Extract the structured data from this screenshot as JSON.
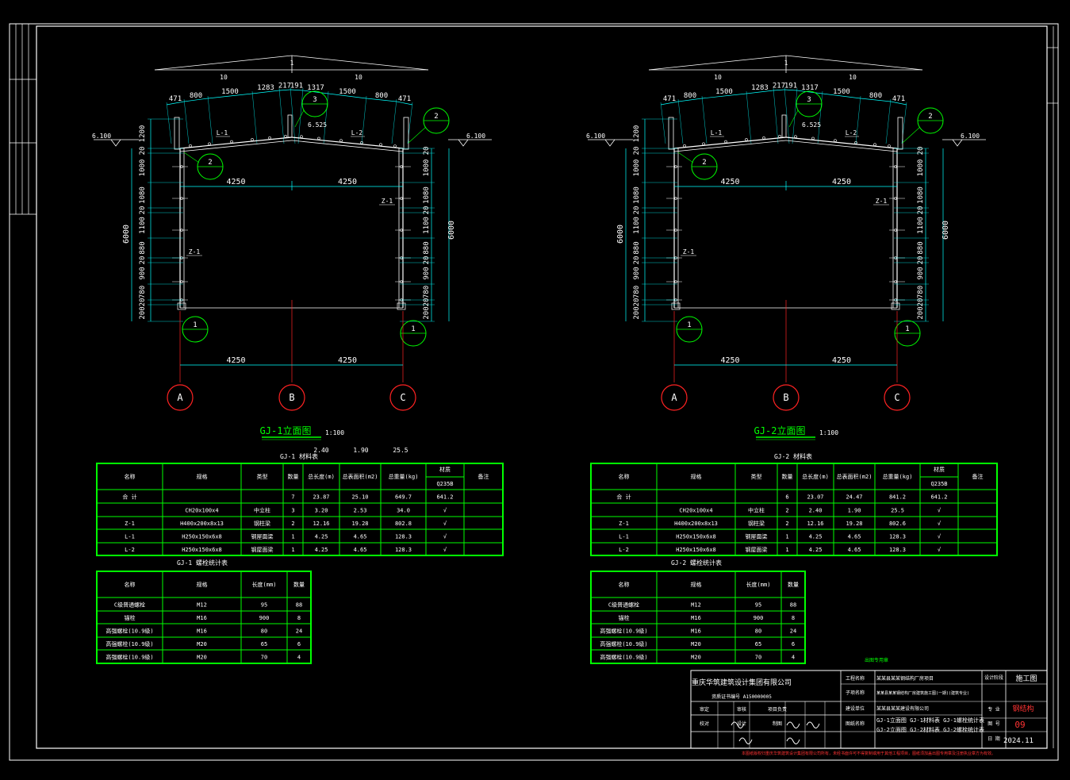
{
  "frames": [
    {
      "id": "gj1",
      "top_dims": [
        "10",
        "10"
      ],
      "top_mark": "1",
      "roof_dims": [
        "471",
        "800",
        "1500",
        "1283",
        "217",
        "191",
        "1317",
        "1500",
        "800",
        "471"
      ],
      "elev_left": "6.100",
      "elev_right": "6.100",
      "elev_mid": "6.525",
      "beam_labels": [
        "L-1",
        "L-2"
      ],
      "col_labels": [
        "Z-1",
        "Z-1"
      ],
      "inner_span": [
        "4250",
        "4250"
      ],
      "bottom_span": [
        "4250",
        "4250"
      ],
      "left_dims": [
        "1200",
        "20",
        "1000",
        "1080",
        "20",
        "1100",
        "880",
        "20",
        "900",
        "780",
        "20",
        "200"
      ],
      "right_dims": [
        "20",
        "1000",
        "1080",
        "20",
        "1100",
        "880",
        "20",
        "900",
        "780",
        "20",
        "200"
      ],
      "height_total": "6000",
      "callouts": [
        "2",
        "3",
        "2",
        "1",
        "1"
      ],
      "axes": [
        "A",
        "B",
        "C"
      ],
      "title": "GJ-1立面图",
      "scale": "1:100",
      "loose_values": [
        "2.40",
        "1.90",
        "25.5"
      ],
      "material_table": {
        "title": "GJ-1 材料表",
        "headers": [
          "名称",
          "规格",
          "类型",
          "数量",
          "总长度(m)",
          "总表面积(m2)",
          "总重量(kg)",
          "材质",
          "备注"
        ],
        "material_sub": "Q235B",
        "rows": [
          [
            "合 计",
            "",
            "",
            "7",
            "23.87",
            "25.10",
            "649.7",
            "641.2",
            ""
          ],
          [
            "",
            "CH20x100x4",
            "中立柱",
            "3",
            "3.20",
            "2.53",
            "34.0",
            "√",
            ""
          ],
          [
            "Z-1",
            "H400x200x8x13",
            "钢柱梁",
            "2",
            "12.16",
            "19.28",
            "802.8",
            "√",
            ""
          ],
          [
            "L-1",
            "H250x150x6x8",
            "钢屋面梁",
            "1",
            "4.25",
            "4.65",
            "128.3",
            "√",
            ""
          ],
          [
            "L-2",
            "H250x150x6x8",
            "钢屋面梁",
            "1",
            "4.25",
            "4.65",
            "128.3",
            "√",
            ""
          ]
        ]
      },
      "bolt_table": {
        "title": "GJ-1 螺栓统计表",
        "headers": [
          "名称",
          "规格",
          "长度(mm)",
          "数量"
        ],
        "rows": [
          [
            "C级普通螺栓",
            "M12",
            "95",
            "88"
          ],
          [
            "锚栓",
            "M16",
            "900",
            "8"
          ],
          [
            "高强螺栓(10.9级)",
            "M16",
            "80",
            "24"
          ],
          [
            "高强螺栓(10.9级)",
            "M20",
            "65",
            "6"
          ],
          [
            "高强螺栓(10.9级)",
            "M20",
            "70",
            "4"
          ]
        ]
      }
    },
    {
      "id": "gj2",
      "top_dims": [
        "10",
        "10"
      ],
      "top_mark": "1",
      "roof_dims": [
        "471",
        "800",
        "1500",
        "1283",
        "217",
        "191",
        "1317",
        "1500",
        "800",
        "471"
      ],
      "elev_left": "6.100",
      "elev_right": "6.100",
      "elev_mid": "6.525",
      "beam_labels": [
        "L-1",
        "L-2"
      ],
      "col_labels": [
        "Z-1",
        "Z-1"
      ],
      "inner_span": [
        "4250",
        "4250"
      ],
      "bottom_span": [
        "4250",
        "4250"
      ],
      "left_dims": [
        "1200",
        "20",
        "1000",
        "1080",
        "20",
        "1100",
        "880",
        "20",
        "900",
        "780",
        "20",
        "200"
      ],
      "right_dims": [
        "20",
        "1000",
        "1080",
        "20",
        "1100",
        "880",
        "20",
        "900",
        "780",
        "20",
        "200"
      ],
      "height_total": "6000",
      "callouts": [
        "2",
        "3",
        "2",
        "1",
        "1"
      ],
      "axes": [
        "A",
        "B",
        "C"
      ],
      "title": "GJ-2立面图",
      "scale": "1:100",
      "loose_values": [],
      "material_table": {
        "title": "GJ-2 材料表",
        "headers": [
          "名称",
          "规格",
          "类型",
          "数量",
          "总长度(m)",
          "总表面积(m2)",
          "总重量(kg)",
          "材质",
          "备注"
        ],
        "material_sub": "Q235B",
        "rows": [
          [
            "合 计",
            "",
            "",
            "6",
            "23.07",
            "24.47",
            "841.2",
            "641.2",
            ""
          ],
          [
            "",
            "CH20x100x4",
            "中立柱",
            "2",
            "2.40",
            "1.90",
            "25.5",
            "√",
            ""
          ],
          [
            "Z-1",
            "H400x200x8x13",
            "钢柱梁",
            "2",
            "12.16",
            "19.28",
            "802.6",
            "√",
            ""
          ],
          [
            "L-1",
            "H250x150x6x8",
            "钢屋面梁",
            "1",
            "4.25",
            "4.65",
            "128.3",
            "√",
            ""
          ],
          [
            "L-2",
            "H250x150x6x8",
            "钢屋面梁",
            "1",
            "4.25",
            "4.65",
            "128.3",
            "√",
            ""
          ]
        ]
      },
      "bolt_table": {
        "title": "GJ-2 螺栓统计表",
        "headers": [
          "名称",
          "规格",
          "长度(mm)",
          "数量"
        ],
        "rows": [
          [
            "C级普通螺栓",
            "M12",
            "95",
            "88"
          ],
          [
            "锚栓",
            "M16",
            "900",
            "8"
          ],
          [
            "高强螺栓(10.9级)",
            "M16",
            "80",
            "24"
          ],
          [
            "高强螺栓(10.9级)",
            "M20",
            "65",
            "6"
          ],
          [
            "高强螺栓(10.9级)",
            "M20",
            "70",
            "4"
          ]
        ]
      }
    }
  ],
  "title_block": {
    "company": "重庆华筑建筑设计集团有限公司",
    "company_sub": "资质证书编号  A150000005",
    "project_label": "工程名称",
    "project": "某某县某某钢结构厂房项目",
    "sub_project_label": "子项名称",
    "sub_project": "某某县某某钢结构厂房建筑施工图(一期)(建筑专业)",
    "unit_label": "建设单位",
    "unit": "某某县某某建设有限公司",
    "drawing_label": "图纸名称",
    "drawing_name_1": "GJ-1立面图  GJ-1材料表  GJ-1螺栓统计表",
    "drawing_name_2": "GJ-2立面图  GJ-2材料表  GJ-2螺栓统计表",
    "stage_label": "设计阶段",
    "stage": "施工图",
    "spec_label": "专 业",
    "spec": "钢结构",
    "num_label": "图 号",
    "num": "09",
    "date_label": "日 期",
    "date": "2024.11",
    "approval_label": "出图专用章",
    "signer_labels": [
      "审定",
      "审核",
      "项目负责",
      "校对",
      "设计",
      "制图"
    ],
    "footer_note": "本图纸版权归重庆华筑建筑设计集团有限公司所有，未经书面许可不得复制或用于其他工程项目，图纸须加盖出图专用章及注册执业章方为有效。"
  },
  "colors": {
    "background": "#000000",
    "frame": "#ffffff",
    "tables": "#00ff00",
    "dimensions": "#00ffff",
    "axes": "#ff2222"
  }
}
